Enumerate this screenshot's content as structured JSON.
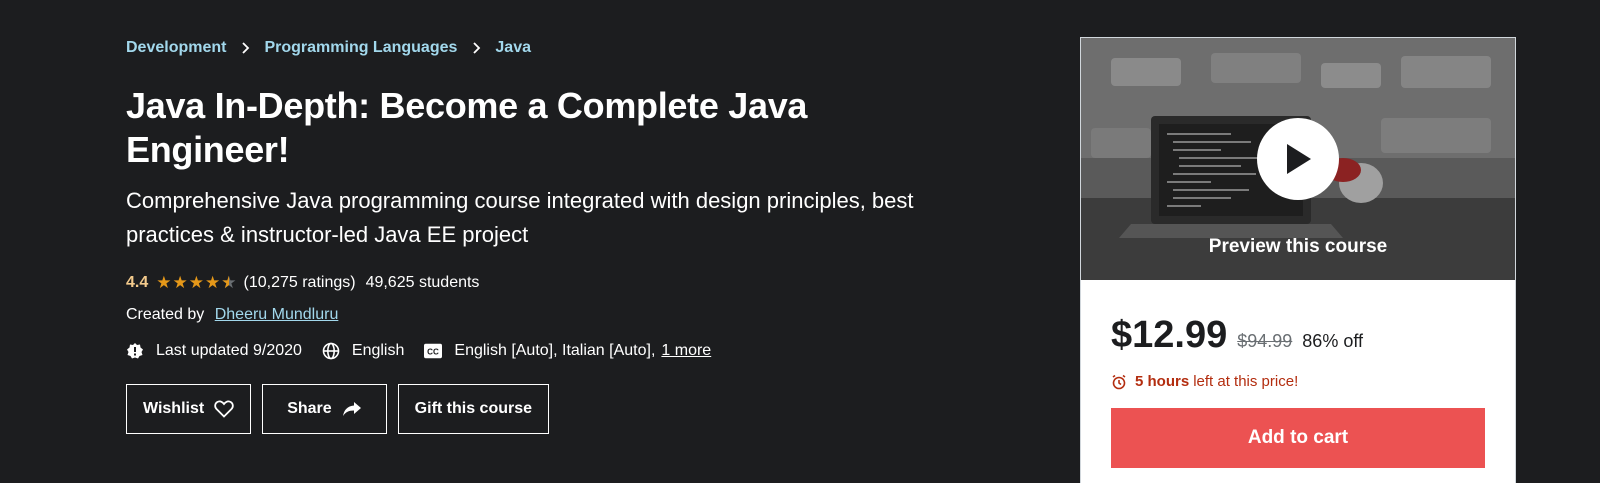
{
  "breadcrumb": [
    {
      "label": "Development"
    },
    {
      "label": "Programming Languages"
    },
    {
      "label": "Java"
    }
  ],
  "course": {
    "title": "Java In-Depth: Become a Complete Java Engineer!",
    "subtitle": "Comprehensive Java programming course integrated with design principles, best practices & instructor-led Java EE project",
    "rating": "4.4",
    "rating_value": 4.4,
    "ratings_count": "(10,275 ratings)",
    "students": "49,625 students",
    "created_by_label": "Created by",
    "instructor": "Dheeru Mundluru",
    "last_updated": "Last updated 9/2020",
    "language": "English",
    "captions": "English [Auto], Italian [Auto],",
    "captions_more": "1 more"
  },
  "buttons": {
    "wishlist": "Wishlist",
    "share": "Share",
    "gift": "Gift this course"
  },
  "card": {
    "preview_label": "Preview this course",
    "price": "$12.99",
    "original_price": "$94.99",
    "discount": "86% off",
    "timer_hours": "5 hours",
    "timer_text": "left at this price!",
    "add_to_cart": "Add to cart"
  },
  "colors": {
    "background": "#1c1d1f",
    "breadcrumb": "#a2d8ec",
    "rating": "#f3ca8c",
    "star": "#e59819",
    "cart_button": "#ec5252",
    "timer": "#b32d0f"
  },
  "icons": {
    "breadcrumb_separator": "chevron-right-icon",
    "last_updated": "alert-badge-icon",
    "language": "globe-icon",
    "captions": "closed-captions-icon",
    "wishlist": "heart-icon",
    "share": "share-arrow-icon",
    "preview": "play-icon",
    "timer": "alarm-clock-icon"
  }
}
